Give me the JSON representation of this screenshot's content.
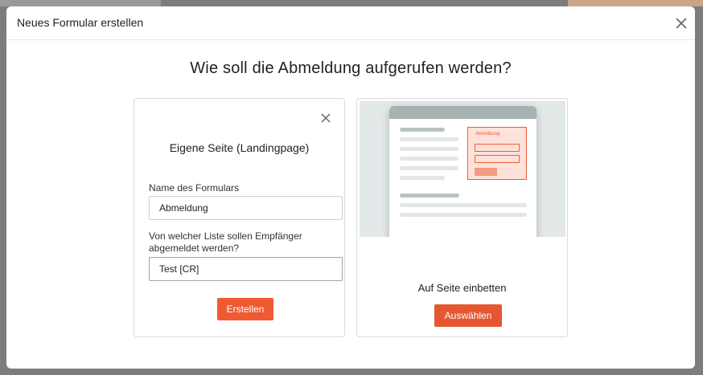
{
  "modal": {
    "title": "Neues Formular erstellen",
    "close_icon": "close-icon",
    "question": "Wie soll die Abmeldung aufgerufen werden?"
  },
  "landing_card": {
    "close_icon": "close-icon",
    "title": "Eigene Seite (Landingpage)",
    "name_label": "Name des Formulars",
    "name_value": "Abmeldung",
    "list_label": "Von welcher Liste sollen Empfänger abgemeldet werden?",
    "list_value": "Test [CR]",
    "create_button": "Erstellen"
  },
  "embed_card": {
    "preview_form_title": "Abmeldung",
    "title": "Auf Seite einbetten",
    "select_button": "Auswählen"
  },
  "colors": {
    "accent": "#f05a33",
    "preview_bg": "#e3e8e9"
  }
}
